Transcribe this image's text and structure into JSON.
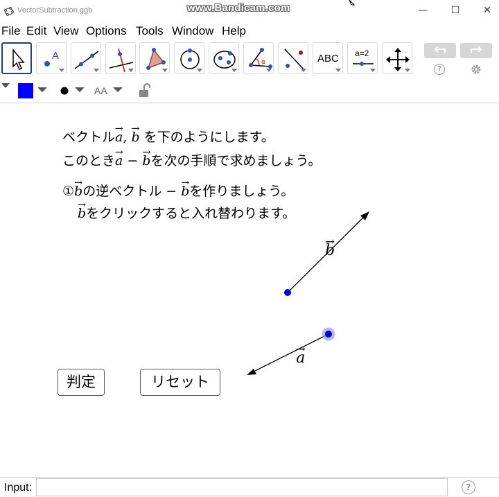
{
  "window": {
    "title": "VectorSubtraction.ggb",
    "watermark": "www.Bandicam.com",
    "minimize": "—",
    "maximize": "☐",
    "close": "✕"
  },
  "menu": [
    "File",
    "Edit",
    "View",
    "Options",
    "Tools",
    "Window",
    "Help"
  ],
  "toolbar": {
    "tools": [
      "move-tool",
      "point-tool",
      "line-tool",
      "perpendicular-line-tool",
      "polygon-tool",
      "circle-tool",
      "ellipse-tool",
      "angle-tool",
      "reflect-tool",
      "text-tool",
      "slider-tool",
      "move-graphics-view-tool"
    ],
    "text_tool_label": "ABC",
    "slider_tool_label": "a=2",
    "help_label": "?"
  },
  "stylebar": {
    "color": "#0000ff",
    "font_size_label": "AA"
  },
  "graphics": {
    "line1": {
      "a": "ベクトル",
      "b": "a",
      "c": ", ",
      "d": "b",
      "e": " を下のようにします。"
    },
    "line2": {
      "a": "このとき",
      "b": "a",
      "c": " − ",
      "d": "b",
      "e": "を次の手順で求めましょう。"
    },
    "line3": {
      "a": "①",
      "b": "b",
      "c": "の逆ベクトル − ",
      "d": "b",
      "e": "を作りましょう。"
    },
    "line4": {
      "b": "b",
      "e": "をクリックすると入れ替わります。"
    },
    "vector_b_label": "b",
    "vector_a_label": "a",
    "judge_button": "判定",
    "reset_button": "リセット",
    "point_color": "#0000cc"
  },
  "input": {
    "label": "Input:",
    "value": "",
    "help_label": "?"
  }
}
